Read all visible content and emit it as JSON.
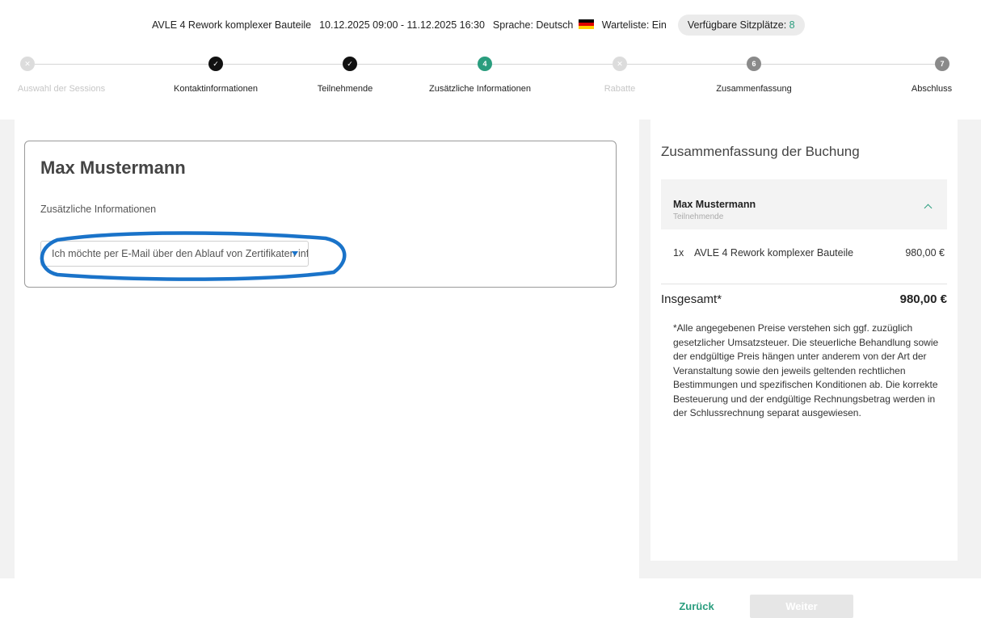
{
  "header": {
    "event_title": "AVLE 4 Rework komplexer Bauteile",
    "date_range": "10.12.2025 09:00 - 11.12.2025 16:30",
    "language": "Sprache: Deutsch",
    "waitlist": "Warteliste: Ein",
    "seats_label": "Verfügbare Sitzplätze:",
    "seats_count": "8",
    "flag_colors": [
      "#000000",
      "#dd0000",
      "#ffce00"
    ]
  },
  "steps": [
    {
      "label": "Auswahl der Sessions",
      "state": "disabled",
      "marker": ""
    },
    {
      "label": "Kontaktinformationen",
      "state": "done",
      "marker": ""
    },
    {
      "label": "Teilnehmende",
      "state": "done",
      "marker": ""
    },
    {
      "label": "Zusätzliche Informationen",
      "state": "active",
      "marker": "4"
    },
    {
      "label": "Rabatte",
      "state": "disabled",
      "marker": ""
    },
    {
      "label": "Zusammenfassung",
      "state": "upcoming",
      "marker": "6"
    },
    {
      "label": "Abschluss",
      "state": "upcoming",
      "marker": "7"
    }
  ],
  "form": {
    "participant_name": "Max Mustermann",
    "field_label": "Zusätzliche Informationen",
    "select_value": "Ich möchte per E-Mail über den Ablauf von Zertifikaten informiert werden"
  },
  "summary": {
    "title": "Zusammenfassung der Buchung",
    "participant_name": "Max Mustermann",
    "participant_role": "Teilnehmende",
    "item_qty": "1x",
    "item_name": "AVLE 4 Rework komplexer Bauteile",
    "item_price": "980,00 €",
    "total_label": "Insgesamt*",
    "total_value": "980,00 €",
    "disclaimer": "*Alle angegebenen Preise verstehen sich ggf. zuzüglich gesetzlicher Umsatzsteuer. Die steuerliche Behandlung sowie der endgültige Preis hängen unter anderem von der Art der Veranstaltung sowie den jeweils geltenden rechtlichen Bestimmungen und spezifischen Konditionen ab. Die korrekte Besteuerung und der endgültige Rechnungsbetrag werden in der Schlussrechnung separat ausgewiesen."
  },
  "footer": {
    "back_label": "Zurück",
    "next_label": "Weiter"
  },
  "colors": {
    "accent": "#2a9d7e",
    "annotation": "#1a73c9"
  }
}
